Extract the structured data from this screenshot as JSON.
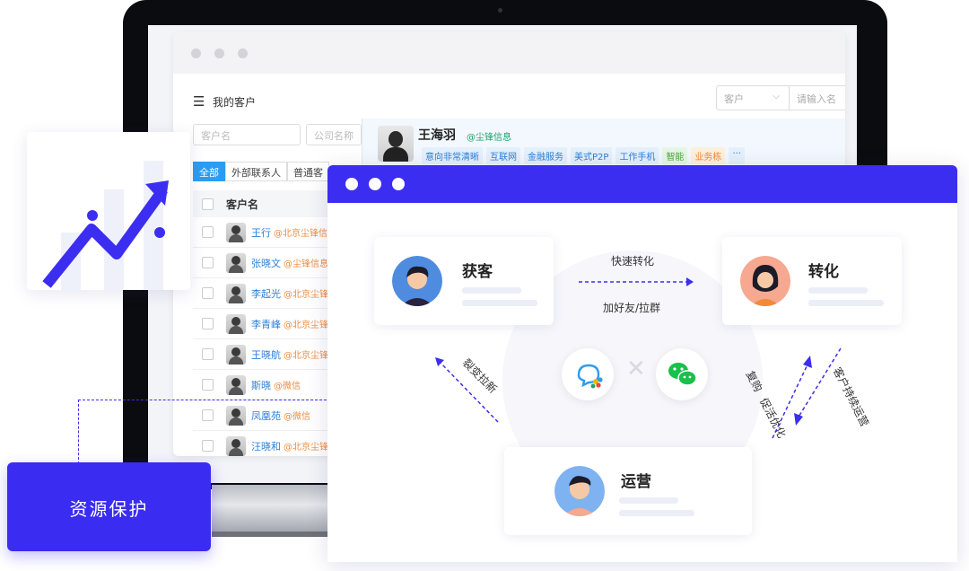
{
  "app": {
    "title": "我的客户",
    "menu_icon": "menu-icon",
    "select_value": "客户",
    "search_placeholder": "请输入名"
  },
  "filters": {
    "customer_name_placeholder": "客户名",
    "company_name_placeholder": "公司名称"
  },
  "tabs": [
    "全部",
    "外部联系人",
    "普通客"
  ],
  "table": {
    "header": "客户名",
    "rows": [
      {
        "name": "王行",
        "org": "@北京尘锋信"
      },
      {
        "name": "张晓文",
        "org": "@尘锋信息"
      },
      {
        "name": "李起光",
        "org": "@北京尘锋"
      },
      {
        "name": "李青峰",
        "org": "@北京尘锋"
      },
      {
        "name": "王晓航",
        "org": "@北京尘锋"
      },
      {
        "name": "斯晓",
        "org": "@微信"
      },
      {
        "name": "凤凰苑",
        "org": "@微信"
      },
      {
        "name": "汪晓和",
        "org": "@北京尘锋"
      }
    ]
  },
  "detail": {
    "name": "王海羽",
    "org": "@尘锋信息",
    "tags": [
      {
        "text": "意向非常清晰",
        "tone": "blue"
      },
      {
        "text": "互联网",
        "tone": "blue"
      },
      {
        "text": "金融服务",
        "tone": "blue"
      },
      {
        "text": "美式P2P",
        "tone": "blue"
      },
      {
        "text": "工作手机",
        "tone": "blue"
      },
      {
        "text": "智能",
        "tone": "green"
      },
      {
        "text": "业务栋",
        "tone": "orange"
      },
      {
        "text": "···",
        "tone": "blue"
      }
    ]
  },
  "flow": {
    "acquire": "获客",
    "convert": "转化",
    "operate": "运营",
    "fast_convert": "快速转化",
    "add_friend": "加好友/拉群",
    "fission": "裂变拉新",
    "repurchase": "复购",
    "promote": "促活优化",
    "customer_ops": "客户持续运营"
  },
  "badge": {
    "label": "资源保护"
  },
  "colors": {
    "brand": "#3c2ef0",
    "link": "#2d7fd6",
    "org": "#f08a3a",
    "green": "#1aa36a"
  }
}
